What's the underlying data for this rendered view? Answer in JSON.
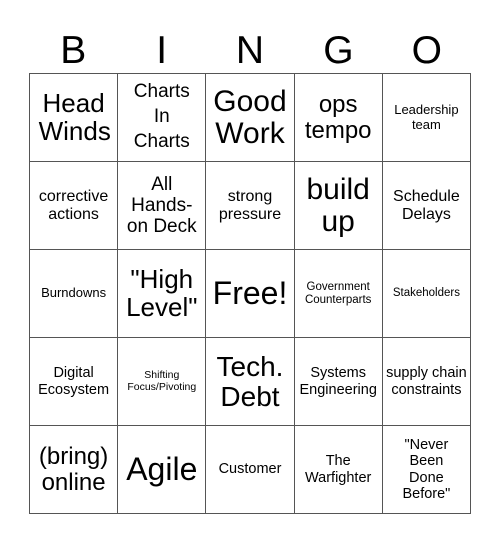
{
  "header": {
    "letters": [
      "B",
      "I",
      "N",
      "G",
      "O"
    ]
  },
  "cells": [
    [
      "Head Winds",
      "Charts In Charts",
      "Good Work",
      "ops tempo",
      "Leadership team"
    ],
    [
      "corrective actions",
      "All Hands-on Deck",
      "strong pressure",
      "build up",
      "Schedule Delays"
    ],
    [
      "Burndowns",
      "\"High Level\"",
      "Free!",
      "Government Counterparts",
      "Stakeholders"
    ],
    [
      "Digital Ecosystem",
      "Shifting Focus/Pivoting",
      "Tech. Debt",
      "Systems Engineering",
      "supply chain constraints"
    ],
    [
      "(bring) online",
      "Agile",
      "Customer",
      "The Warfighter",
      "\"Never Been Done Before\""
    ]
  ],
  "colors": {
    "grid_line": "#555555",
    "text": "#000000",
    "background": "#ffffff"
  }
}
